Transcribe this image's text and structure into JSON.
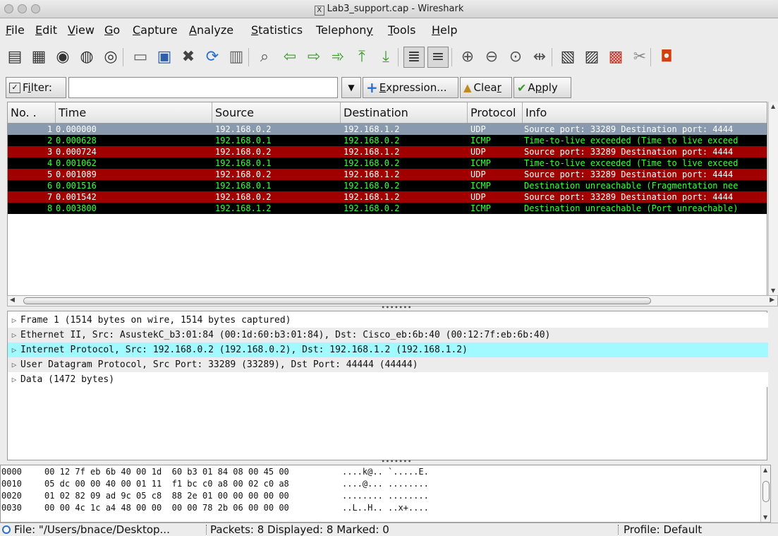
{
  "window": {
    "title": "Lab3_support.cap - Wireshark",
    "x11_badge": "X"
  },
  "menu": [
    {
      "label": "File",
      "u": "F",
      "rest": "ile"
    },
    {
      "label": "Edit",
      "u": "E",
      "rest": "dit"
    },
    {
      "label": "View",
      "u": "V",
      "rest": "iew"
    },
    {
      "label": "Go",
      "u": "G",
      "rest": "o"
    },
    {
      "label": "Capture",
      "u": "C",
      "rest": "apture"
    },
    {
      "label": "Analyze",
      "u": "A",
      "rest": "nalyze"
    },
    {
      "label": "Statistics",
      "u": "S",
      "rest": "tatistics"
    },
    {
      "label": "Telephony",
      "pre": "Telephon",
      "u": "y",
      "rest": ""
    },
    {
      "label": "Tools",
      "u": "T",
      "rest": "ools"
    },
    {
      "label": "Help",
      "u": "H",
      "rest": "elp"
    }
  ],
  "toolbar_icons": [
    {
      "name": "interfaces-icon",
      "glyph": "▤",
      "color": "#333"
    },
    {
      "name": "capture-options-icon",
      "glyph": "▦",
      "color": "#333"
    },
    {
      "name": "start-capture-icon",
      "glyph": "◉",
      "color": "#333"
    },
    {
      "name": "stop-capture-icon",
      "glyph": "◍",
      "color": "#333"
    },
    {
      "name": "restart-capture-icon",
      "glyph": "◎",
      "color": "#333"
    },
    {
      "name": "open-file-icon",
      "glyph": "▭",
      "color": "#666"
    },
    {
      "name": "save-file-icon",
      "glyph": "▣",
      "color": "#2f5fa8"
    },
    {
      "name": "close-file-icon",
      "glyph": "✖",
      "color": "#444"
    },
    {
      "name": "reload-icon",
      "glyph": "⟳",
      "color": "#2a6fd0"
    },
    {
      "name": "print-icon",
      "glyph": "▥",
      "color": "#666"
    },
    {
      "name": "find-packet-icon",
      "glyph": "⌕",
      "color": "#555"
    },
    {
      "name": "go-back-icon",
      "glyph": "⇦",
      "color": "#3a9a2a"
    },
    {
      "name": "go-forward-icon",
      "glyph": "⇨",
      "color": "#3a9a2a"
    },
    {
      "name": "go-to-packet-icon",
      "glyph": "➾",
      "color": "#3a9a2a"
    },
    {
      "name": "first-packet-icon",
      "glyph": "⤒",
      "color": "#3a9a2a"
    },
    {
      "name": "last-packet-icon",
      "glyph": "⤓",
      "color": "#3a9a2a"
    },
    {
      "name": "colorize-icon",
      "glyph": "≣",
      "color": "#333"
    },
    {
      "name": "auto-scroll-icon",
      "glyph": "≡",
      "color": "#333"
    },
    {
      "name": "zoom-in-icon",
      "glyph": "⊕",
      "color": "#555"
    },
    {
      "name": "zoom-out-icon",
      "glyph": "⊖",
      "color": "#555"
    },
    {
      "name": "zoom-normal-icon",
      "glyph": "⊙",
      "color": "#555"
    },
    {
      "name": "resize-columns-icon",
      "glyph": "⇹",
      "color": "#555"
    },
    {
      "name": "capture-filters-icon",
      "glyph": "▧",
      "color": "#333"
    },
    {
      "name": "display-filters-icon",
      "glyph": "▨",
      "color": "#333"
    },
    {
      "name": "coloring-rules-icon",
      "glyph": "▩",
      "color": "#c0392b"
    },
    {
      "name": "preferences-icon",
      "glyph": "✂",
      "color": "#888"
    },
    {
      "name": "help-icon",
      "glyph": "◘",
      "color": "#d04010"
    }
  ],
  "filter": {
    "label_u": "i",
    "label_pre": "F",
    "label_rest": "lter:",
    "value": "",
    "expression_u": "E",
    "expression_rest": "xpression...",
    "clear_pre": "Clea",
    "clear_u": "r",
    "apply_pre": "A",
    "apply_u": "p",
    "apply_rest": "ply"
  },
  "packet_list": {
    "columns": [
      "No. .",
      "Time",
      "Source",
      "Destination",
      "Protocol",
      "Info"
    ],
    "rows": [
      {
        "no": "1",
        "time": "0.000000",
        "src": "192.168.0.2",
        "dst": "192.168.1.2",
        "proto": "UDP",
        "info": "Source port: 33289  Destination port: 4444",
        "style": "selected"
      },
      {
        "no": "2",
        "time": "0.000628",
        "src": "192.168.0.1",
        "dst": "192.168.0.2",
        "proto": "ICMP",
        "info": "Time-to-live exceeded (Time to live exceed",
        "style": "icmp"
      },
      {
        "no": "3",
        "time": "0.000724",
        "src": "192.168.0.2",
        "dst": "192.168.1.2",
        "proto": "UDP",
        "info": "Source port: 33289  Destination port: 4444",
        "style": "udp"
      },
      {
        "no": "4",
        "time": "0.001062",
        "src": "192.168.0.1",
        "dst": "192.168.0.2",
        "proto": "ICMP",
        "info": "Time-to-live exceeded (Time to live exceed",
        "style": "icmp"
      },
      {
        "no": "5",
        "time": "0.001089",
        "src": "192.168.0.2",
        "dst": "192.168.1.2",
        "proto": "UDP",
        "info": "Source port: 33289  Destination port: 4444",
        "style": "udp"
      },
      {
        "no": "6",
        "time": "0.001516",
        "src": "192.168.0.1",
        "dst": "192.168.0.2",
        "proto": "ICMP",
        "info": "Destination unreachable (Fragmentation nee",
        "style": "icmp"
      },
      {
        "no": "7",
        "time": "0.001542",
        "src": "192.168.0.2",
        "dst": "192.168.1.2",
        "proto": "UDP",
        "info": "Source port: 33289  Destination port: 4444",
        "style": "udp"
      },
      {
        "no": "8",
        "time": "0.003800",
        "src": "192.168.1.2",
        "dst": "192.168.0.2",
        "proto": "ICMP",
        "info": "Destination unreachable (Port unreachable)",
        "style": "icmp"
      }
    ]
  },
  "colors": {
    "selected_bg": "#8a9aae",
    "selected_fg": "#ffffff",
    "udp_bg": "#a00000",
    "udp_fg": "#ffffff",
    "icmp_bg": "#000000",
    "icmp_fg": "#3cff3c",
    "highlight_row": "#a0faff"
  },
  "details": [
    {
      "text": "Frame 1 (1514 bytes on wire, 1514 bytes captured)",
      "highlight": false
    },
    {
      "text": "Ethernet II, Src: AsustekC_b3:01:84 (00:1d:60:b3:01:84), Dst: Cisco_eb:6b:40 (00:12:7f:eb:6b:40)",
      "highlight": false
    },
    {
      "text": "Internet Protocol, Src: 192.168.0.2 (192.168.0.2), Dst: 192.168.1.2 (192.168.1.2)",
      "highlight": true
    },
    {
      "text": "User Datagram Protocol, Src Port: 33289 (33289), Dst Port: 44444 (44444)",
      "highlight": false
    },
    {
      "text": "Data (1472 bytes)",
      "highlight": false
    }
  ],
  "hex": [
    {
      "off": "0000",
      "bytes": "00 12 7f eb 6b 40 00 1d  60 b3 01 84 08 00 45 00",
      "ascii": "....k@.. `.....E."
    },
    {
      "off": "0010",
      "bytes": "05 dc 00 00 40 00 01 11  f1 bc c0 a8 00 02 c0 a8",
      "ascii": "....@... ........"
    },
    {
      "off": "0020",
      "bytes": "01 02 82 09 ad 9c 05 c8  88 2e 01 00 00 00 00 00",
      "ascii": "........ ........"
    },
    {
      "off": "0030",
      "bytes": "00 00 4c 1c a4 48 00 00  00 00 78 2b 06 00 00 00",
      "ascii": "..L..H.. ..x+...."
    }
  ],
  "status": {
    "file": "File: \"/Users/bnace/Desktop...",
    "packets": "Packets: 8 Displayed: 8 Marked: 0",
    "profile": "Profile: Default"
  }
}
